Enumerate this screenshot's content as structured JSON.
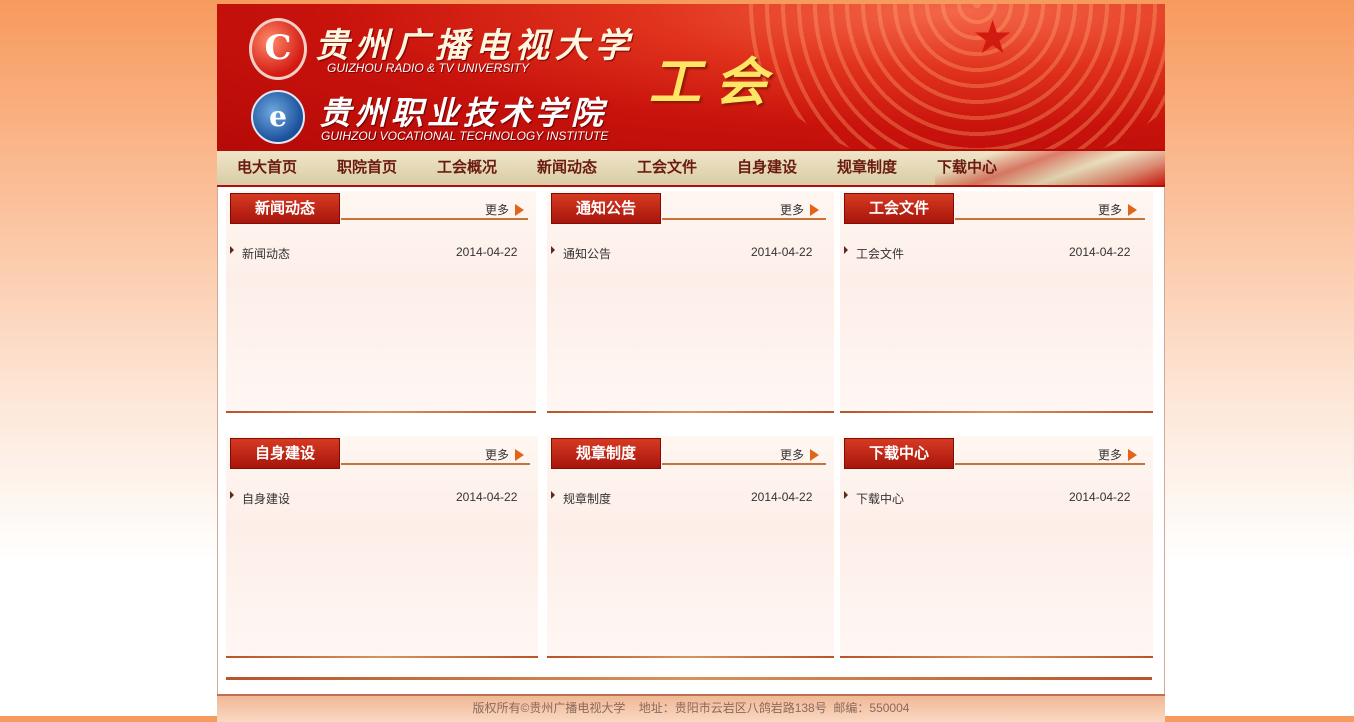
{
  "banner": {
    "university_cn": "贵州广播电视大学",
    "university_en": "GUIZHOU RADIO & TV UNIVERSITY",
    "institute_cn": "贵州职业技术学院",
    "institute_en": "GUIHZOU VOCATIONAL TECHNOLOGY INSTITUTE",
    "section_title": "工会",
    "logo1_glyph": "C",
    "logo2_glyph": "e"
  },
  "nav": {
    "items": [
      "电大首页",
      "职院首页",
      "工会概况",
      "新闻动态",
      "工会文件",
      "自身建设",
      "规章制度",
      "下载中心"
    ]
  },
  "panels": [
    {
      "title": "新闻动态",
      "more": "更多",
      "items": [
        {
          "title": "新闻动态",
          "date": "2014-04-22"
        }
      ]
    },
    {
      "title": "通知公告",
      "more": "更多",
      "items": [
        {
          "title": "通知公告",
          "date": "2014-04-22"
        }
      ]
    },
    {
      "title": "工会文件",
      "more": "更多",
      "items": [
        {
          "title": "工会文件",
          "date": "2014-04-22"
        }
      ]
    },
    {
      "title": "自身建设",
      "more": "更多",
      "items": [
        {
          "title": "自身建设",
          "date": "2014-04-22"
        }
      ]
    },
    {
      "title": "规章制度",
      "more": "更多",
      "items": [
        {
          "title": "规章制度",
          "date": "2014-04-22"
        }
      ]
    },
    {
      "title": "下载中心",
      "more": "更多",
      "items": [
        {
          "title": "下载中心",
          "date": "2014-04-22"
        }
      ]
    }
  ],
  "footer": {
    "text": "版权所有©贵州广播电视大学    地址：贵阳市云岩区八鸽岩路138号  邮编：550004"
  },
  "colors": {
    "banner_red": "#c8120c",
    "title_gold": "#ffe566",
    "nav_text": "#6a1a10",
    "tab_red": "#a8150c",
    "more_arrow": "#e2641a"
  }
}
